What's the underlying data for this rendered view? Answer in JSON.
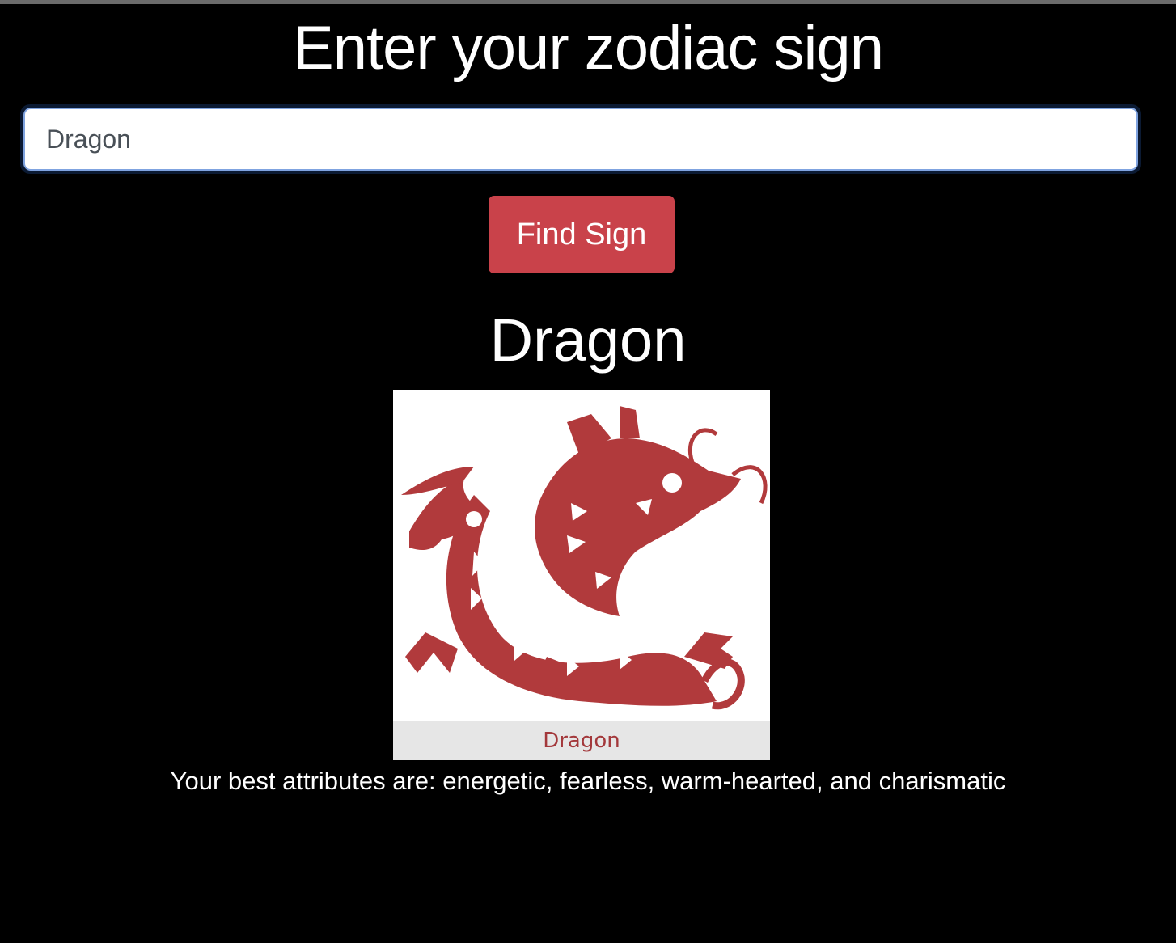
{
  "page": {
    "title": "Enter your zodiac sign"
  },
  "search": {
    "value": "Dragon"
  },
  "actions": {
    "find_label": "Find Sign"
  },
  "result": {
    "sign_name": "Dragon",
    "image_caption": "Dragon",
    "image_icon": "dragon-illustration",
    "attributes_text": "Your best attributes are: energetic, fearless, warm-hearted, and charismatic"
  },
  "colors": {
    "background": "#000000",
    "button": "#c9424a",
    "dragon": "#b13a3c",
    "input_focus": "#7fa3e0"
  }
}
